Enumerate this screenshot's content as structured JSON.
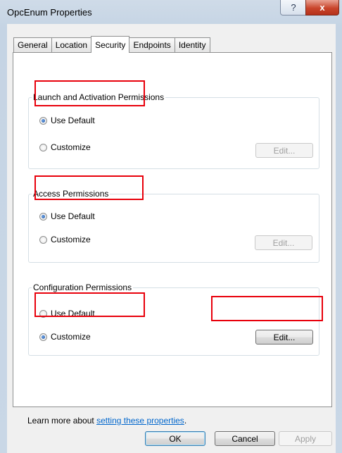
{
  "window": {
    "title": "OpcEnum Properties",
    "help_glyph": "?",
    "close_glyph": "x"
  },
  "tabs": [
    {
      "label": "General",
      "active": false
    },
    {
      "label": "Location",
      "active": false
    },
    {
      "label": "Security",
      "active": true
    },
    {
      "label": "Endpoints",
      "active": false
    },
    {
      "label": "Identity",
      "active": false
    }
  ],
  "groups": {
    "launch": {
      "title": "Launch and Activation Permissions",
      "use_default": "Use Default",
      "customize": "Customize",
      "selected": "use_default",
      "edit": "Edit...",
      "edit_enabled": false
    },
    "access": {
      "title": "Access Permissions",
      "use_default": "Use Default",
      "customize": "Customize",
      "selected": "use_default",
      "edit": "Edit...",
      "edit_enabled": false
    },
    "configuration": {
      "title": "Configuration Permissions",
      "use_default": "Use Default",
      "customize": "Customize",
      "selected": "customize",
      "edit": "Edit...",
      "edit_enabled": true
    }
  },
  "learn_more": {
    "prefix": "Learn more about ",
    "link": "setting these properties",
    "suffix": "."
  },
  "footer": {
    "ok": "OK",
    "cancel": "Cancel",
    "apply": "Apply"
  },
  "colors": {
    "highlight": "#e8000b",
    "link": "#0066cc",
    "radio_selected": "#1b4fa0"
  }
}
